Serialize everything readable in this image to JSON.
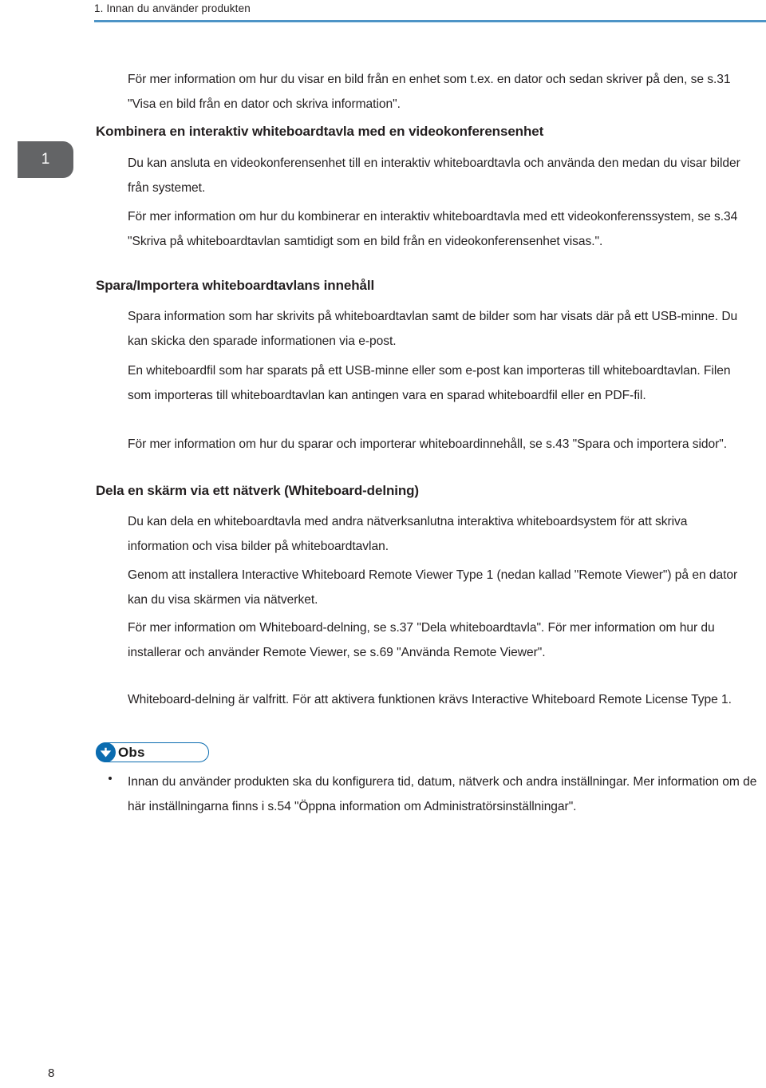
{
  "page": {
    "running_header": "1. Innan du använder produkten",
    "chapter_tab_number": "1",
    "folio": "8",
    "accent_rule_color": "#4d94c6",
    "tab_color": "#636466",
    "note_accent_color": "#0b6cb0"
  },
  "blocks": {
    "intro_para": "För mer information om hur du visar en bild från en enhet som t.ex. en dator och sedan skriver på den, se s.31 \"Visa en bild från en dator och skriva information\".",
    "heading_combine": "Kombinera en interaktiv whiteboardtavla med en videokonferensenhet",
    "combine_para_1": "Du kan ansluta en videokonferensenhet till en interaktiv whiteboardtavla och använda den medan du visar bilder från systemet.",
    "combine_para_2": "För mer information om hur du kombinerar en interaktiv whiteboardtavla med ett videokonferenssystem, se s.34 \"Skriva på whiteboardtavlan samtidigt som en bild från en videokonferensenhet visas.\".",
    "heading_save_import": "Spara/Importera whiteboardtavlans innehåll",
    "save_para_1": "Spara information som har skrivits på whiteboardtavlan samt de bilder som har visats där på ett USB-minne. Du kan skicka den sparade informationen via e-post.",
    "save_para_2": "En whiteboardfil som har sparats på ett USB-minne eller som e-post kan importeras till whiteboardtavlan. Filen som importeras till whiteboardtavlan kan antingen vara en sparad whiteboardfil eller en PDF-fil.",
    "save_para_3": "För mer information om hur du sparar och importerar whiteboardinnehåll, se s.43 \"Spara och importera sidor\".",
    "heading_share_screen": "Dela en skärm via ett nätverk (Whiteboard-delning)",
    "share_para_1": "Du kan dela en whiteboardtavla med andra nätverksanlutna interaktiva whiteboardsystem för att skriva information och visa bilder på whiteboardtavlan.",
    "share_para_2": "Genom att installera Interactive Whiteboard Remote Viewer Type 1 (nedan kallad \"Remote Viewer\") på en dator kan du visa skärmen via nätverket.",
    "share_para_3": "För mer information om Whiteboard-delning, se s.37 \"Dela whiteboardtavla\". För mer information om hur du installerar och använder Remote Viewer, se s.69 \"Använda Remote Viewer\".",
    "share_para_4": "Whiteboard-delning är valfritt. För att aktivera funktionen krävs Interactive Whiteboard Remote License Type 1."
  },
  "note": {
    "badge_label": "Obs",
    "badge_icon": "down-arrow-icon",
    "items": [
      "Innan du använder produkten ska du konfigurera tid, datum, nätverk och andra inställningar. Mer information om de här inställningarna finns i s.54 \"Öppna information om Administratörsinställningar\"."
    ]
  }
}
